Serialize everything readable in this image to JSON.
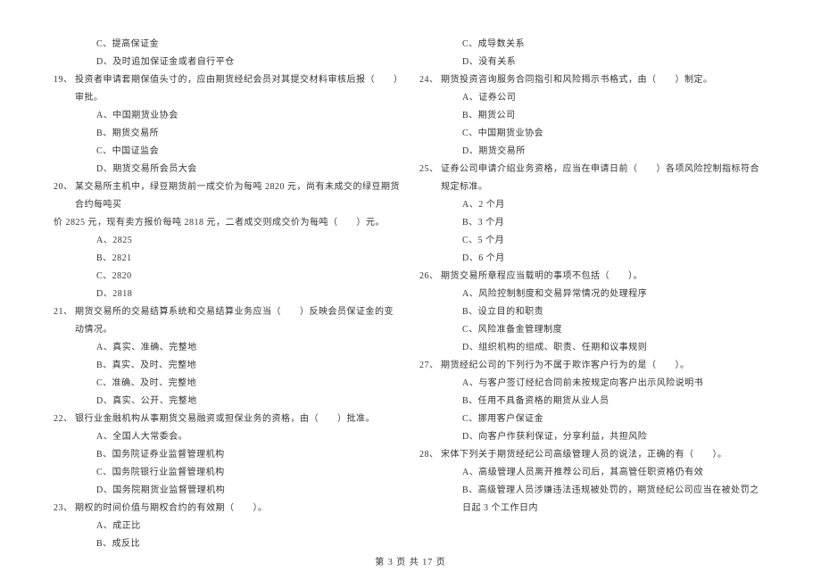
{
  "left": {
    "q18": {
      "optC": "C、提高保证金",
      "optD": "D、及时追加保证金或者自行平仓"
    },
    "q19": {
      "num": "19、",
      "text": "投资者申请套期保值头寸的，应由期货经纪会员对其提交材料审核后报（　　）审批。",
      "optA": "A、中国期货业协会",
      "optB": "B、期货交易所",
      "optC": "C、中国证监会",
      "optD": "D、期货交易所会员大会"
    },
    "q20": {
      "num": "20、",
      "text": "某交易所主机中，绿豆期货前一成交价为每吨 2820 元，尚有未成交的绿豆期货合约每吨买",
      "cont": "价 2825 元，现有卖方报价每吨 2818 元，二者成交则成交价为每吨（　　）元。",
      "optA": "A、2825",
      "optB": "B、2821",
      "optC": "C、2820",
      "optD": "D、2818"
    },
    "q21": {
      "num": "21、",
      "text": "期货交易所的交易结算系统和交易结算业务应当（　　）反映会员保证金的变动情况。",
      "optA": "A、真实、准确、完整地",
      "optB": "B、真实、及时、完整地",
      "optC": "C、准确、及时、完整地",
      "optD": "D、真实、公开、完整地"
    },
    "q22": {
      "num": "22、",
      "text": "银行业金融机构从事期货交易融资或担保业务的资格，由（　　）批准。",
      "optA": "A、全国人大常委会。",
      "optB": "B、国务院证券业监督管理机构",
      "optC": "C、国务院银行业监督管理机构",
      "optD": "D、国务院期货业监督管理机构"
    },
    "q23": {
      "num": "23、",
      "text": "期权的时间价值与期权合约的有效期（　　）。",
      "optA": "A、成正比",
      "optB": "B、成反比"
    }
  },
  "right": {
    "q23": {
      "optC": "C、成导数关系",
      "optD": "D、没有关系"
    },
    "q24": {
      "num": "24、",
      "text": "期货投资咨询服务合同指引和风险揭示书格式，由（　　）制定。",
      "optA": "A、证券公司",
      "optB": "B、期货公司",
      "optC": "C、中国期货业协会",
      "optD": "D、期货交易所"
    },
    "q25": {
      "num": "25、",
      "text": "证券公司申请介绍业务资格，应当在申请日前（　　）各项风险控制指标符合规定标准。",
      "optA": "A、2 个月",
      "optB": "B、3 个月",
      "optC": "C、5 个月",
      "optD": "D、6 个月"
    },
    "q26": {
      "num": "26、",
      "text": "期货交易所章程应当载明的事项不包括（　　）。",
      "optA": "A、风险控制制度和交易异常情况的处理程序",
      "optB": "B、设立目的和职责",
      "optC": "C、风险准备金管理制度",
      "optD": "D、组织机构的组成、职责、任期和议事规则"
    },
    "q27": {
      "num": "27、",
      "text": "期货经纪公司的下列行为不属于欺诈客户行为的是（　　）。",
      "optA": "A、与客户签订经纪合同前未按规定向客户出示风险说明书",
      "optB": "B、任用不具备资格的期货从业人员",
      "optC": "C、挪用客户保证金",
      "optD": "D、向客户作获利保证，分享利益，共担风险"
    },
    "q28": {
      "num": "28、",
      "text": "宋体下列关于期货经纪公司高级管理人员的说法，正确的有（　　）。",
      "optA": "A、高级管理人员离开推荐公司后，其高管任职资格仍有效",
      "optB": "B、高级管理人员涉嫌违法违规被处罚的，期货经纪公司应当在被处罚之日起 3 个工作日内"
    }
  },
  "footer": "第 3 页 共 17 页"
}
